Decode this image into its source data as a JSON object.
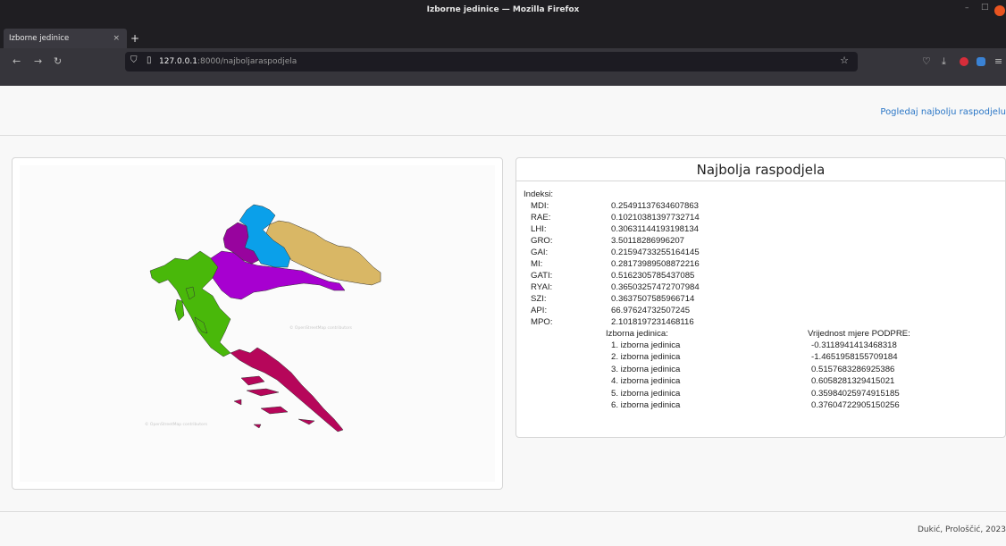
{
  "browser": {
    "window_title": "Izborne jedinice — Mozilla Firefox",
    "tab_title": "Izborne jedinice",
    "tab_close": "×",
    "new_tab": "+",
    "url_host": "127.0.0.1",
    "url_path": ":8000/najboljaraspodjela",
    "icons": [
      "back-icon",
      "forward-icon",
      "reload-icon",
      "shield-icon",
      "page-icon",
      "star-icon",
      "pocket-icon",
      "download-icon",
      "extension-icon",
      "menu-icon"
    ]
  },
  "header": {
    "link_label": "Pogledaj najbolju raspodjelu"
  },
  "map": {
    "watermarks": [
      "© OpenStreetMap contributors",
      "© OpenStreetMap contributors"
    ],
    "colors": {
      "unit1": "#49b80a",
      "unit2": "#98049e",
      "unit3": "#0aa0ea",
      "unit4": "#a700d0",
      "unit5": "#d9b765",
      "unit6": "#b6065a"
    }
  },
  "result": {
    "title": "Najbolja raspodjela",
    "indeksi_label": "Indeksi:",
    "indices": [
      {
        "key": "MDI:",
        "value": "0.25491137634607863"
      },
      {
        "key": "RAE:",
        "value": "0.10210381397732714"
      },
      {
        "key": "LHI:",
        "value": "0.30631144193198134"
      },
      {
        "key": "GRO:",
        "value": "3.50118286996207"
      },
      {
        "key": "GAI:",
        "value": "0.21594733255164145"
      },
      {
        "key": "MI:",
        "value": "0.28173989508872216"
      },
      {
        "key": "GATI:",
        "value": "0.5162305785437085"
      },
      {
        "key": "RYAI:",
        "value": "0.36503257472707984"
      },
      {
        "key": "SZI:",
        "value": "0.3637507585966714"
      },
      {
        "key": "API:",
        "value": "66.97624732507245"
      },
      {
        "key": "MPO:",
        "value": "2.1018197231468116"
      }
    ],
    "unit_header": "Izborna jedinica:",
    "value_header": "Vrijednost mjere PODPRE:",
    "units": [
      {
        "name": "1. izborna jedinica",
        "value": "-0.3118941413468318"
      },
      {
        "name": "2. izborna jedinica",
        "value": "-1.4651958155709184"
      },
      {
        "name": "3. izborna jedinica",
        "value": "0.5157683286925386"
      },
      {
        "name": "4. izborna jedinica",
        "value": "0.6058281329415021"
      },
      {
        "name": "5. izborna jedinica",
        "value": "0.35984025974915185"
      },
      {
        "name": "6. izborna jedinica",
        "value": "0.37604722905150256"
      }
    ]
  },
  "footer": {
    "text": "Dukić, Prološčić, 2023"
  }
}
